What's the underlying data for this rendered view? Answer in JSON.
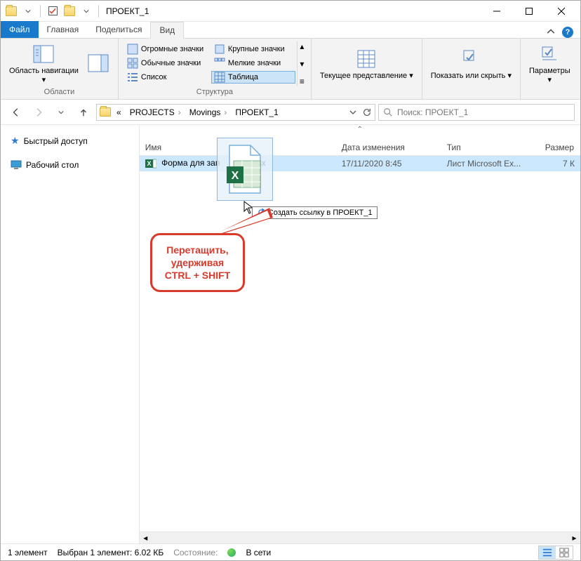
{
  "title": "ПРОЕКТ_1",
  "tabs": {
    "file": "Файл",
    "home": "Главная",
    "share": "Поделиться",
    "view": "Вид"
  },
  "ribbon": {
    "panes_group": "Области",
    "nav_pane": "Область навигации",
    "layout_group": "Структура",
    "huge_icons": "Огромные значки",
    "large_icons": "Крупные значки",
    "normal_icons": "Обычные значки",
    "small_icons": "Мелкие значки",
    "list": "Список",
    "table": "Таблица",
    "current_view_group": "Текущее представление",
    "current_view": "Текущее представление",
    "show_hide_group": "Показать или скрыть",
    "show_hide": "Показать или скрыть",
    "options": "Параметры"
  },
  "breadcrumb": {
    "prefix": "«",
    "p1": "PROJECTS",
    "p2": "Movings",
    "p3": "ПРОЕКТ_1"
  },
  "search_placeholder": "Поиск: ПРОЕКТ_1",
  "sidebar": {
    "quick": "Быстрый доступ",
    "desktop": "Рабочий стол"
  },
  "columns": {
    "name": "Имя",
    "date": "Дата изменения",
    "type": "Тип",
    "size": "Размер"
  },
  "file": {
    "name": "Форма для зап",
    "ext": "sx",
    "date": "17/11/2020 8:45",
    "type": "Лист Microsoft Ex...",
    "size": "7 К"
  },
  "drag_tip": "Создать ссылку в ПРОЕКТ_1",
  "callout_l1": "Перетащить,",
  "callout_l2": "удерживая",
  "callout_l3": "CTRL + SHIFT",
  "status": {
    "count": "1 элемент",
    "selected": "Выбран 1 элемент: 6.02 КБ",
    "state_label": "Состояние:",
    "network": "В сети"
  }
}
